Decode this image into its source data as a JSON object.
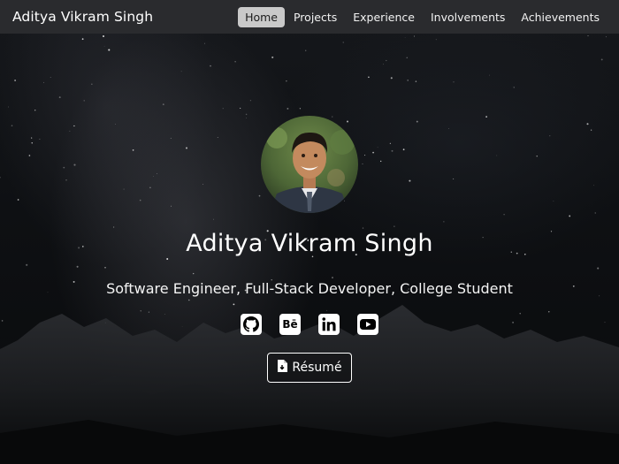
{
  "navbar": {
    "brand": "Aditya Vikram Singh",
    "items": [
      {
        "label": "Home",
        "active": true
      },
      {
        "label": "Projects",
        "active": false
      },
      {
        "label": "Experience",
        "active": false
      },
      {
        "label": "Involvements",
        "active": false
      },
      {
        "label": "Achievements",
        "active": false
      }
    ]
  },
  "hero": {
    "name": "Aditya Vikram Singh",
    "subtitle": "Software Engineer, Full-Stack Developer, College Student",
    "socials": [
      {
        "icon": "github-icon"
      },
      {
        "icon": "behance-icon"
      },
      {
        "icon": "linkedin-icon"
      },
      {
        "icon": "youtube-icon"
      }
    ],
    "resume": {
      "icon": "file-icon",
      "label": "Résumé"
    }
  },
  "colors": {
    "navbar_bg": "#2a2b2e",
    "active_pill": "#c9c9c9",
    "text": "#ffffff"
  }
}
